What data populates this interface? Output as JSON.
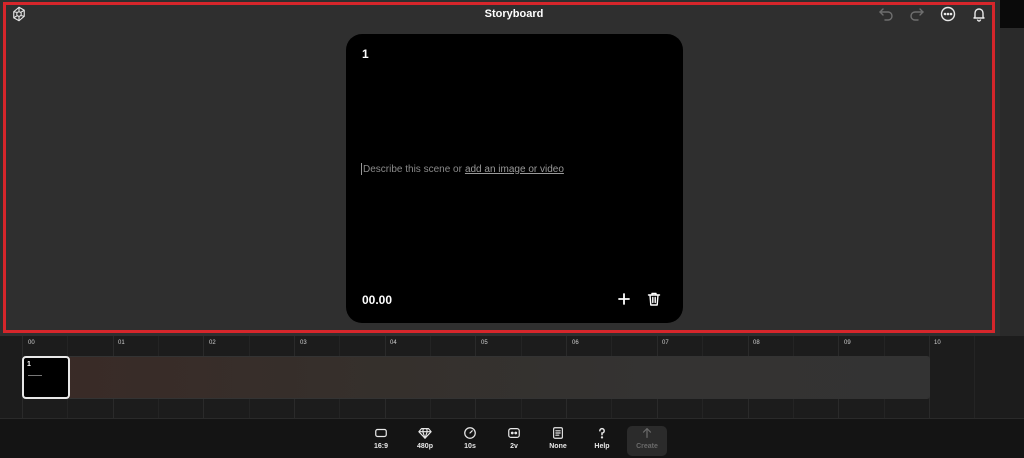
{
  "header": {
    "title": "Storyboard",
    "logo_icon": "openai-logo-icon",
    "actions": [
      {
        "name": "undo-icon"
      },
      {
        "name": "redo-icon"
      },
      {
        "name": "more-options-icon"
      },
      {
        "name": "notifications-bell-icon"
      }
    ]
  },
  "scene": {
    "number": "1",
    "placeholder": "Describe this scene or",
    "link_text": "add an image or video",
    "time": "00.00"
  },
  "timeline": {
    "ticks": [
      "00",
      "01",
      "02",
      "03",
      "04",
      "05",
      "06",
      "07",
      "08",
      "09",
      "10"
    ],
    "clip": {
      "number": "1"
    }
  },
  "toolbar": {
    "aspect": "16:9",
    "resolution": "480p",
    "duration": "10s",
    "variations": "2v",
    "preset": "None",
    "help": "Help",
    "create": "Create"
  },
  "colors": {
    "highlight": "#d6262b",
    "background": "#2f2f2f",
    "card": "#000000"
  }
}
